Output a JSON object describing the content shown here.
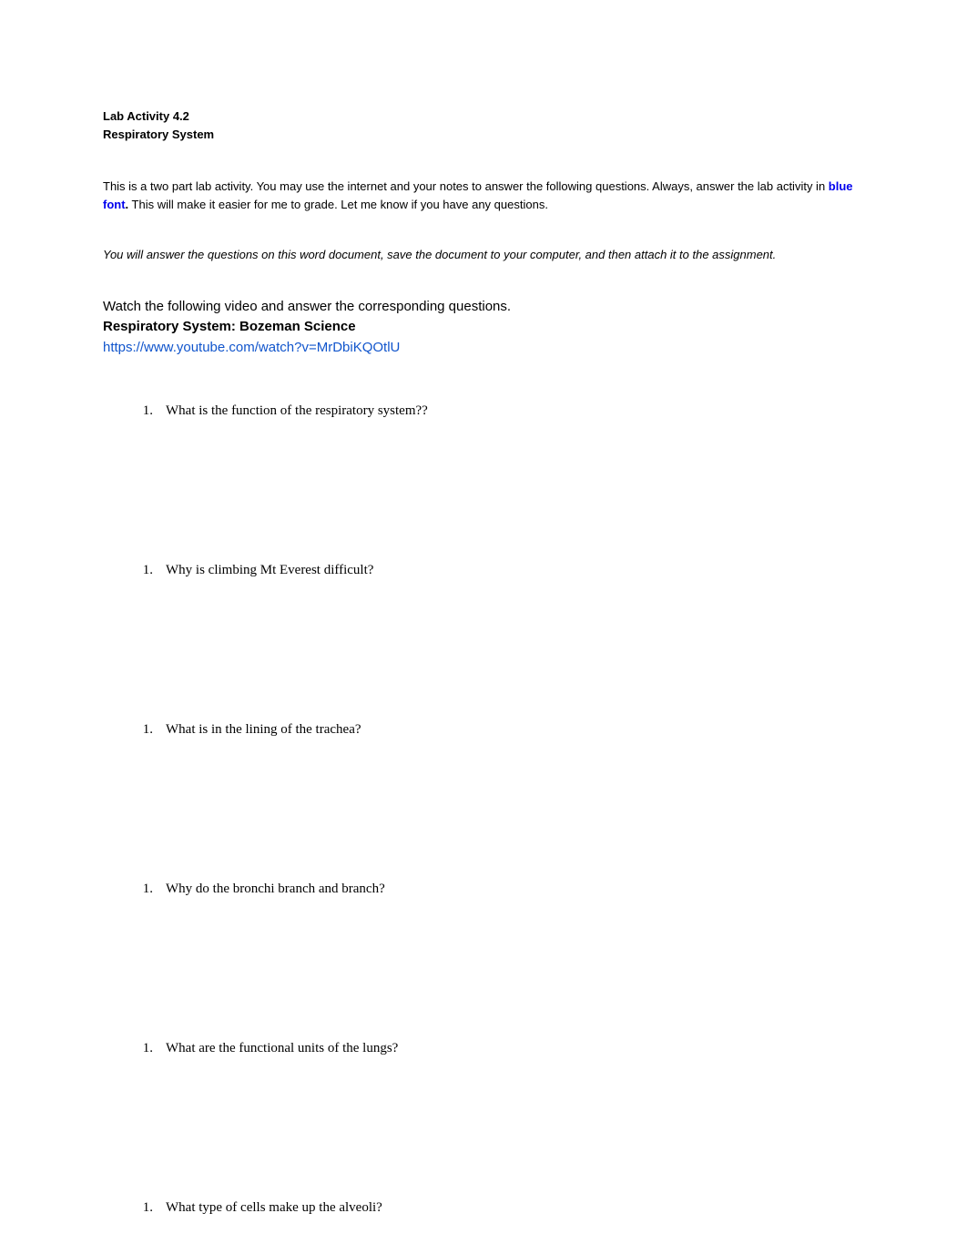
{
  "header": {
    "title": "Lab Activity 4.2",
    "subtitle": "Respiratory System"
  },
  "intro": {
    "text_part1": "This is a two part lab activity. You may use the internet and your notes to answer the following questions. Always, answer the lab activity in ",
    "blue_font": "blue font",
    "period": ".",
    "text_part2": " This will make it easier for me to grade. Let me know if you have any questions."
  },
  "note": "You will answer the questions on this word document, save the document to your computer, and then attach it to the assignment.",
  "video": {
    "intro": "Watch the following video and answer the corresponding questions.",
    "title": "Respiratory System: Bozeman Science",
    "link": "https://www.youtube.com/watch?v=MrDbiKQOtlU"
  },
  "questions": [
    {
      "number": "1.",
      "text": "What is the function of the respiratory system??"
    },
    {
      "number": "1.",
      "text": "Why is climbing Mt Everest difficult?"
    },
    {
      "number": "1.",
      "text": "What is in the lining of the trachea?"
    },
    {
      "number": "1.",
      "text": "Why do the bronchi branch and branch?"
    },
    {
      "number": "1.",
      "text": "What are the functional units of the lungs?"
    },
    {
      "number": "1.",
      "text": "What type of cells make up the alveoli?"
    }
  ]
}
